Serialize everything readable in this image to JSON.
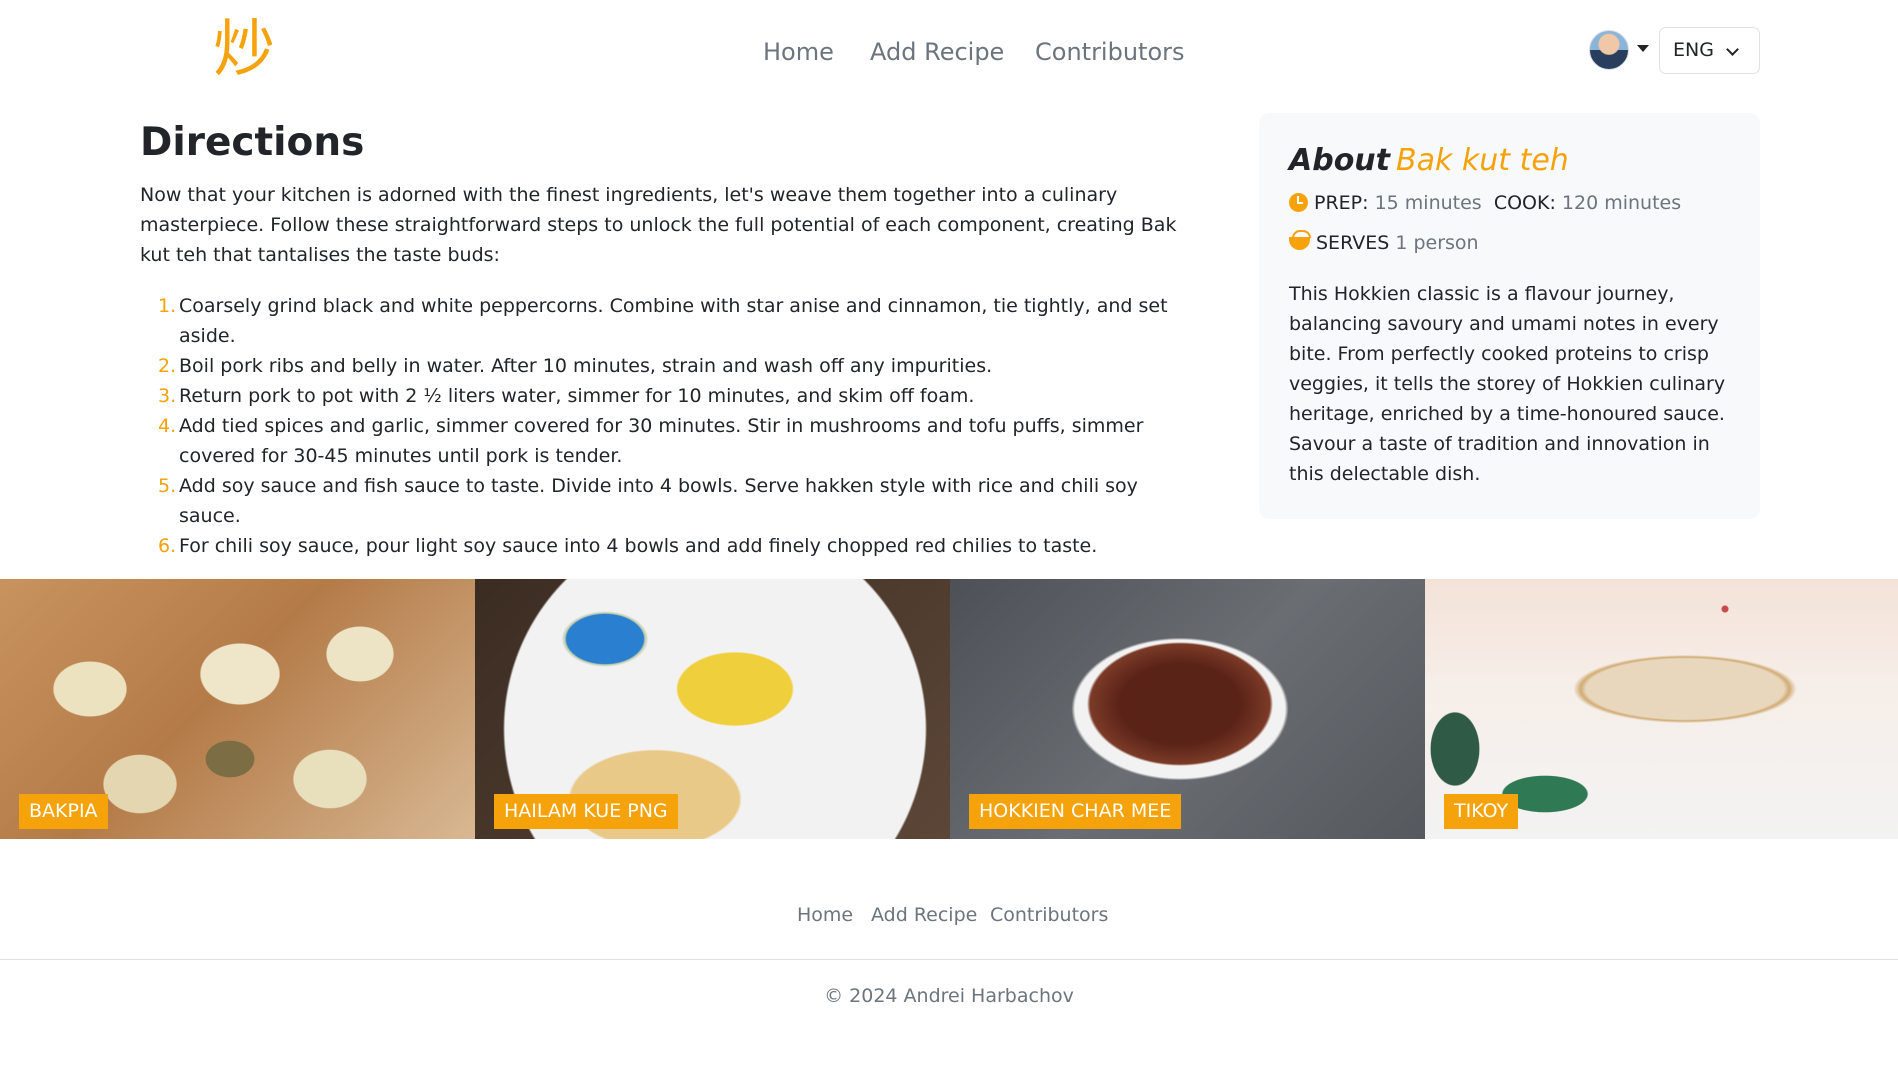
{
  "header": {
    "logo_char": "炒",
    "nav": [
      "Home",
      "Add Recipe",
      "Contributors"
    ],
    "language": "ENG"
  },
  "directions": {
    "title": "Directions",
    "intro": "Now that your kitchen is adorned with the finest ingredients, let's weave them together into a culinary masterpiece. Follow these straightforward steps to unlock the full potential of each component, creating Bak kut teh that tantalises the taste buds:",
    "steps": [
      "Coarsely grind black and white peppercorns. Combine with star anise and cinnamon, tie tightly, and set aside.",
      "Boil pork ribs and belly in water. After 10 minutes, strain and wash off any impurities.",
      "Return pork to pot with 2 ½ liters water, simmer for 10 minutes, and skim off foam.",
      "Add tied spices and garlic, simmer covered for 30 minutes. Stir in mushrooms and tofu puffs, simmer covered for 30-45 minutes until pork is tender.",
      "Add soy sauce and fish sauce to taste. Divide into 4 bowls. Serve hakken style with rice and chili soy sauce.",
      "For chili soy sauce, pour light soy sauce into 4 bowls and add finely chopped red chilies to taste."
    ]
  },
  "about": {
    "prefix": "About",
    "recipe_name": "Bak kut teh",
    "prep_label": "PREP:",
    "prep_value": "15 minutes",
    "cook_label": "COOK:",
    "cook_value": "120 minutes",
    "serves_label": "SERVES",
    "serves_value": "1 person",
    "description": "This Hokkien classic is a flavour journey, balancing savoury and umami notes in every bite. From perfectly cooked proteins to crisp veggies, it tells the storey of Hokkien culinary heritage, enriched by a time-honoured sauce. Savour a taste of tradition and innovation in this delectable dish."
  },
  "gallery": [
    {
      "label": "BAKPIA"
    },
    {
      "label": "HAILAM KUE PNG"
    },
    {
      "label": "HOKKIEN CHAR MEE"
    },
    {
      "label": "TIKOY"
    }
  ],
  "footer": {
    "nav": [
      "Home",
      "Add Recipe",
      "Contributors"
    ],
    "copyright": "© 2024 Andrei Harbachov"
  },
  "colors": {
    "accent": "#f5a20b",
    "muted": "#6c757d",
    "card_bg": "#f8f9fa"
  }
}
